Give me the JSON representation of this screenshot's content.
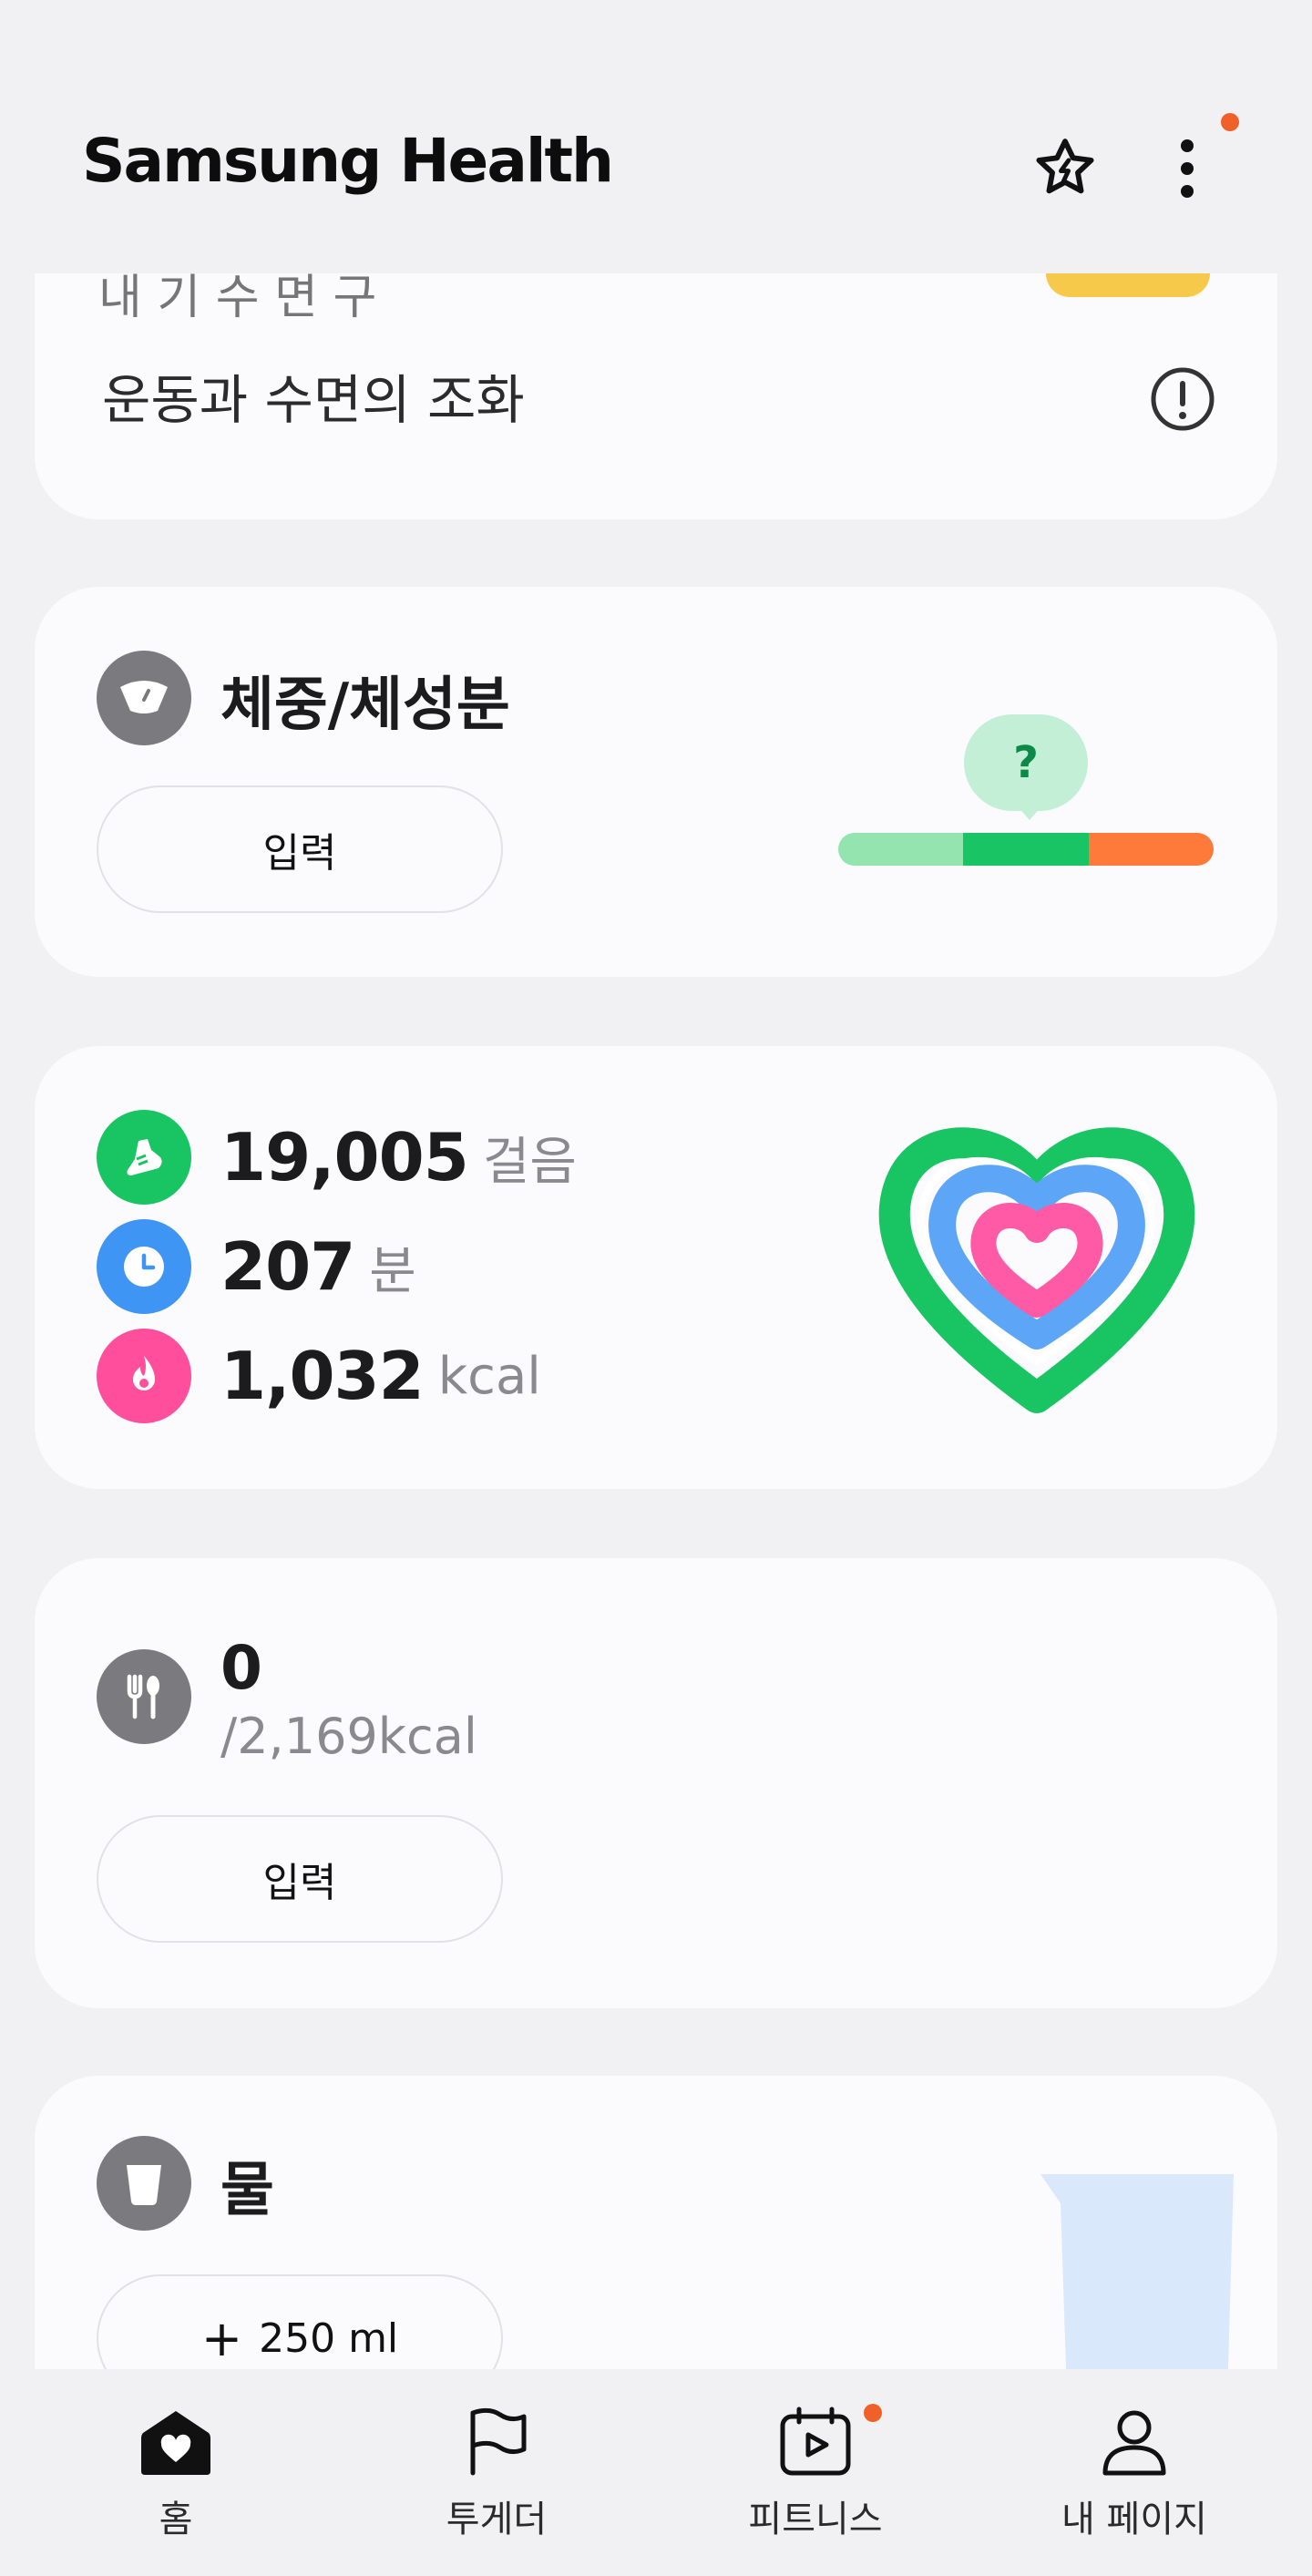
{
  "app": {
    "title": "Samsung Health"
  },
  "top_card": {
    "partial_text": "내 기 수 면 구",
    "label": "운동과 수면의 조화"
  },
  "weight_card": {
    "title": "체중/체성분",
    "button_label": "입력",
    "bubble_text": "?"
  },
  "activity_card": {
    "steps_value": "19,005",
    "steps_unit": "걸음",
    "minutes_value": "207",
    "minutes_unit": "분",
    "kcal_value": "1,032",
    "kcal_unit": "kcal"
  },
  "food_card": {
    "value": "0",
    "goal": "/2,169kcal",
    "button_label": "입력"
  },
  "water_card": {
    "title": "물",
    "button_label": "250 ml"
  },
  "bottom_nav": [
    {
      "label": "홈",
      "icon": "home-heart-icon"
    },
    {
      "label": "투게더",
      "icon": "flag-icon"
    },
    {
      "label": "피트니스",
      "icon": "fitness-play-icon"
    },
    {
      "label": "내 페이지",
      "icon": "person-icon"
    }
  ],
  "colors": {
    "steps": "#19c563",
    "active": "#3f95f4",
    "calories": "#ff4f9c",
    "notification": "#f0612a",
    "background": "#f1f1f3",
    "card": "#fbfbfd"
  }
}
